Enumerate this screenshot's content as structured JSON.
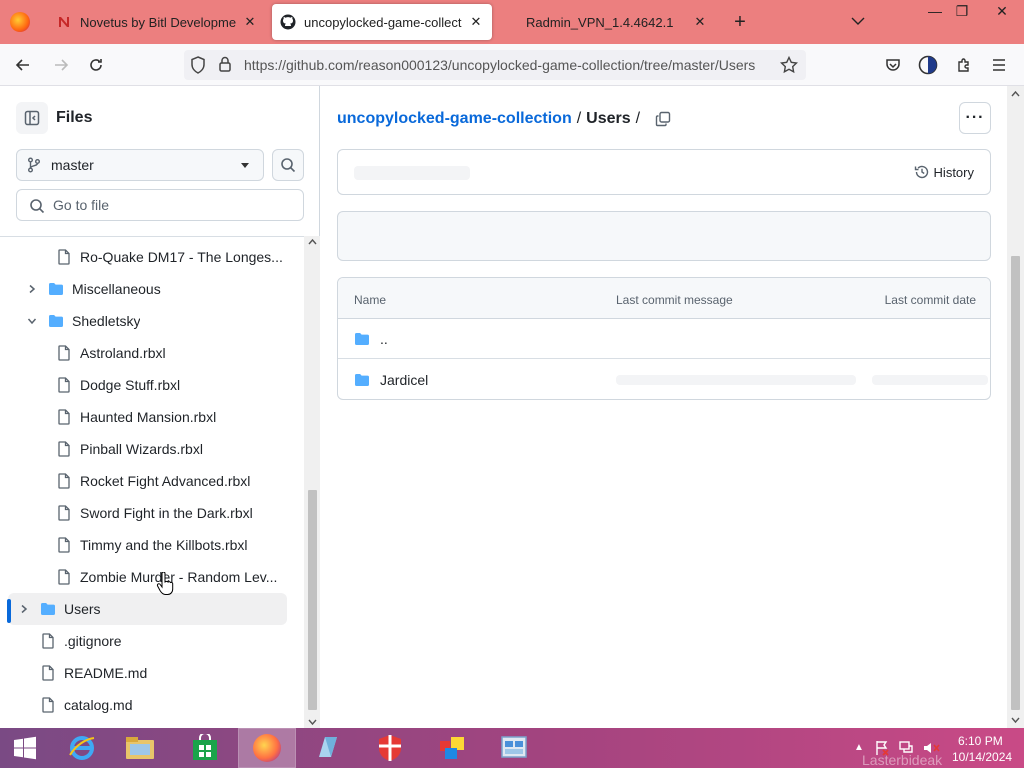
{
  "browser": {
    "tabs": [
      {
        "label": "Novetus by Bitl Development S",
        "active": false
      },
      {
        "label": "uncopylocked-game-collection",
        "active": true
      },
      {
        "label": "Radmin_VPN_1.4.4642.1",
        "active": false
      }
    ],
    "new_tab_symbol": "+",
    "list_tabs_symbol": "⌄",
    "window_buttons": {
      "minimize": "—",
      "restore": "❐",
      "close": "✕"
    },
    "url": "https://github.com/reason000123/uncopylocked-game-collection/tree/master/Users"
  },
  "sidebar": {
    "title": "Files",
    "branch": "master",
    "goto_placeholder": "Go to file",
    "tree": [
      {
        "label": "Ro-Quake DM17 - The Longes...",
        "type": "file",
        "level": 2
      },
      {
        "label": "Miscellaneous",
        "type": "folder",
        "level": 1,
        "expanded": false
      },
      {
        "label": "Shedletsky",
        "type": "folder",
        "level": 1,
        "expanded": true
      },
      {
        "label": "Astroland.rbxl",
        "type": "file",
        "level": 2
      },
      {
        "label": "Dodge Stuff.rbxl",
        "type": "file",
        "level": 2
      },
      {
        "label": "Haunted Mansion.rbxl",
        "type": "file",
        "level": 2
      },
      {
        "label": "Pinball Wizards.rbxl",
        "type": "file",
        "level": 2
      },
      {
        "label": "Rocket Fight Advanced.rbxl",
        "type": "file",
        "level": 2
      },
      {
        "label": "Sword Fight in the Dark.rbxl",
        "type": "file",
        "level": 2
      },
      {
        "label": "Timmy and the Killbots.rbxl",
        "type": "file",
        "level": 2
      },
      {
        "label": "Zombie Murder - Random Lev...",
        "type": "file",
        "level": 2
      },
      {
        "label": "Users",
        "type": "folder",
        "level": 0,
        "expanded": false,
        "selected": true
      },
      {
        "label": ".gitignore",
        "type": "file",
        "level": 0
      },
      {
        "label": "README.md",
        "type": "file",
        "level": 0
      },
      {
        "label": "catalog.md",
        "type": "file",
        "level": 0
      }
    ]
  },
  "main": {
    "breadcrumb": {
      "repo": "uncopylocked-game-collection",
      "sep": "/",
      "current": "Users"
    },
    "more_symbol": "···",
    "history_label": "History",
    "table": {
      "headers": {
        "name": "Name",
        "message": "Last commit message",
        "date": "Last commit date"
      },
      "rows": [
        {
          "name": "..",
          "type": "folder"
        },
        {
          "name": "Jardicel",
          "type": "folder"
        }
      ]
    }
  },
  "taskbar": {
    "time": "6:10 PM",
    "date": "10/14/2024",
    "watermark": "Lasterbideak"
  },
  "colors": {
    "tab_strip": "#ec7f7f",
    "link": "#0969da",
    "folder": "#54aeff",
    "taskbar": "#a4447f"
  }
}
